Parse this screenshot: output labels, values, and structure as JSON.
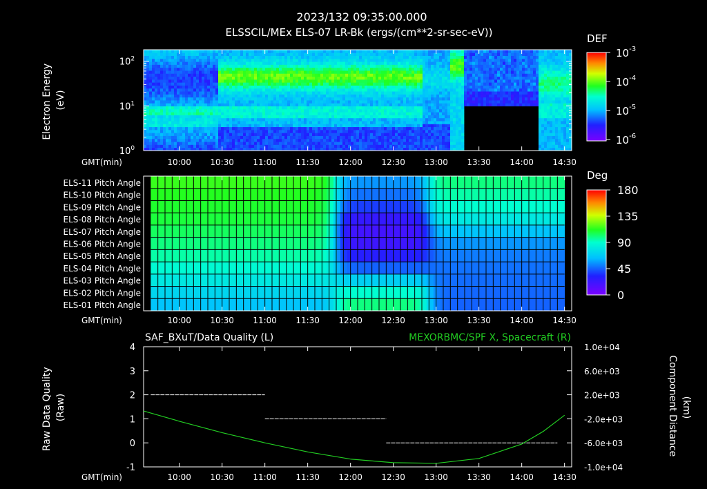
{
  "header": {
    "timestamp": "2023/132 09:35:00.000",
    "title": "ELSSCIL/MEx ELS-07 LR-Bk  (ergs/(cm**2-sr-sec-eV))"
  },
  "time_axis": {
    "label": "GMT(min)",
    "ticks": [
      "10:00",
      "10:30",
      "11:00",
      "11:30",
      "12:00",
      "12:30",
      "13:00",
      "13:30",
      "14:00",
      "14:30"
    ]
  },
  "colors": {
    "background": "#000000",
    "text": "#ffffff",
    "spacecraft_line": "#22cc22",
    "quality_line": "#ffffff",
    "right_title": "#22cc22"
  },
  "chart_data": [
    {
      "type": "heatmap",
      "name": "energy-spectrogram",
      "ylabel": "Electron Energy\n(eV)",
      "ylabel_lines": [
        "Electron Energy",
        "(eV)"
      ],
      "yscale": "log",
      "yticks": [
        {
          "base": "10",
          "exp": "0"
        },
        {
          "base": "10",
          "exp": "1"
        },
        {
          "base": "10",
          "exp": "2"
        }
      ],
      "ylim": [
        1,
        180
      ],
      "x_range": [
        "09:35",
        "14:35"
      ],
      "colorbar": {
        "title": "DEF",
        "scale": "log",
        "ticks": [
          {
            "base": "10",
            "exp": "-3"
          },
          {
            "base": "10",
            "exp": "-4"
          },
          {
            "base": "10",
            "exp": "-5"
          },
          {
            "base": "10",
            "exp": "-6"
          }
        ]
      }
    },
    {
      "type": "heatmap",
      "name": "pitch-angle",
      "rows": [
        "ELS-11 Pitch Angle",
        "ELS-10 Pitch Angle",
        "ELS-09 Pitch Angle",
        "ELS-08 Pitch Angle",
        "ELS-07 Pitch Angle",
        "ELS-06 Pitch Angle",
        "ELS-05 Pitch Angle",
        "ELS-04 Pitch Angle",
        "ELS-03 Pitch Angle",
        "ELS-02 Pitch Angle",
        "ELS-01 Pitch Angle"
      ],
      "x_range": [
        "09:40",
        "14:30"
      ],
      "colorbar": {
        "title": "Deg",
        "ticks": [
          "180",
          "135",
          "90",
          "45",
          "0"
        ],
        "range": [
          0,
          180
        ]
      },
      "pre_values": [
        115,
        112,
        110,
        108,
        104,
        100,
        95,
        88,
        80,
        72,
        65
      ],
      "mid_values": [
        55,
        48,
        38,
        25,
        20,
        22,
        30,
        45,
        70,
        90,
        100
      ],
      "post_values": [
        100,
        95,
        90,
        80,
        65,
        55,
        50,
        48,
        47,
        46,
        45
      ]
    },
    {
      "type": "line",
      "name": "data-quality-and-spf-x",
      "left_title": "SAF_BXuT/Data Quality (L)",
      "right_title": "MEXORBMC/SPF X, Spacecraft (R)",
      "ylabel_left_lines": [
        "Raw Data Quality",
        "(Raw)"
      ],
      "ylabel_right_lines": [
        "Component Distance",
        "(km)"
      ],
      "yleft_ticks": [
        "4",
        "3",
        "2",
        "1",
        "0",
        "-1"
      ],
      "yleft_lim": [
        -1,
        4
      ],
      "yright_ticks": [
        "1.0e+04",
        "6.0e+03",
        "2.0e+03",
        "-2.0e+03",
        "-6.0e+03",
        "-1.0e+04"
      ],
      "yright_lim": [
        -10000,
        10000
      ],
      "series": [
        {
          "axis": "left",
          "segments": [
            {
              "x0": "09:40",
              "x1": "11:00",
              "y": 2
            },
            {
              "x0": "11:00",
              "x1": "12:25",
              "y": 1
            },
            {
              "x0": "12:25",
              "x1": "14:25",
              "y": 0
            }
          ]
        },
        {
          "axis": "right",
          "x": [
            "09:35",
            "10:00",
            "10:30",
            "11:00",
            "11:30",
            "12:00",
            "12:30",
            "13:00",
            "13:30",
            "14:00",
            "14:15",
            "14:30"
          ],
          "y": [
            -700,
            -2400,
            -4300,
            -6000,
            -7500,
            -8700,
            -9300,
            -9400,
            -8600,
            -6200,
            -4100,
            -1400
          ]
        }
      ]
    }
  ]
}
